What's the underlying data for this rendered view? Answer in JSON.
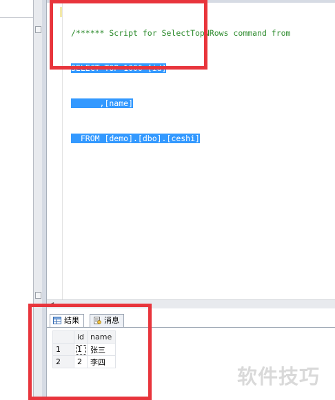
{
  "editor": {
    "lines": [
      "/****** Script for SelectTopNRows command from",
      "SELECT TOP 1000 [id]",
      "      ,[name]",
      "  FROM [demo].[dbo].[ceshi]"
    ]
  },
  "results": {
    "tabs": [
      {
        "label": "结果",
        "icon": "grid-icon"
      },
      {
        "label": "消息",
        "icon": "messages-icon"
      }
    ],
    "columns": [
      "id",
      "name"
    ],
    "rows": [
      {
        "row_num": "1",
        "id": "1",
        "name": "张三"
      },
      {
        "row_num": "2",
        "id": "2",
        "name": "李四"
      }
    ]
  },
  "watermark": "软件技巧",
  "colors": {
    "selection": "#3399ff",
    "annotation_red": "#e8353c",
    "comment_green": "#2b8a2b"
  }
}
